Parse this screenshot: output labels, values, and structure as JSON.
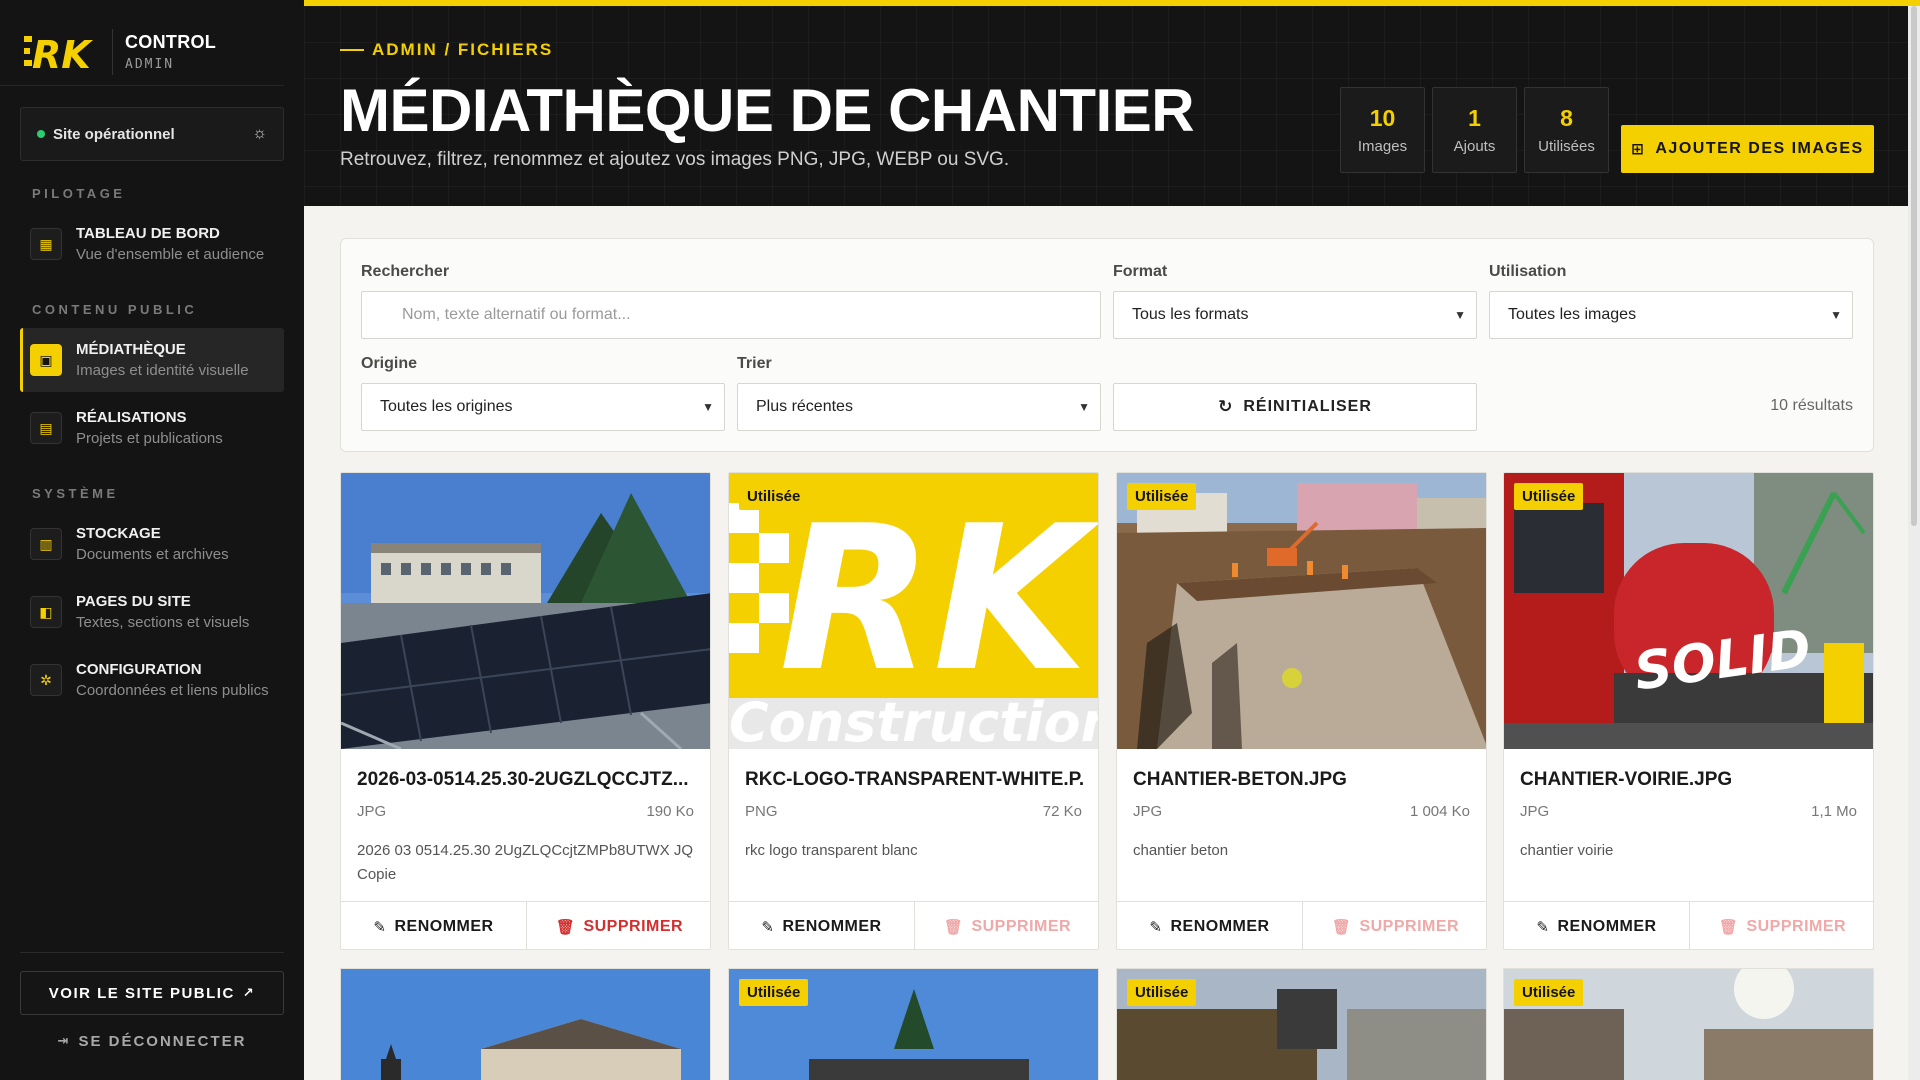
{
  "brand": {
    "logo_text": "RK",
    "title": "CONTROL",
    "subtitle": "ADMIN"
  },
  "status": {
    "text": "Site opérationnel",
    "color": "#2ecc71"
  },
  "sidebar": {
    "sections": [
      "PILOTAGE",
      "CONTENU PUBLIC",
      "SYSTÈME"
    ],
    "items": [
      {
        "label": "TABLEAU DE BORD",
        "desc": "Vue d'ensemble et audience"
      },
      {
        "label": "MÉDIATHÈQUE",
        "desc": "Images et identité visuelle"
      },
      {
        "label": "RÉALISATIONS",
        "desc": "Projets et publications"
      },
      {
        "label": "STOCKAGE",
        "desc": "Documents et archives"
      },
      {
        "label": "PAGES DU SITE",
        "desc": "Textes, sections et visuels"
      },
      {
        "label": "CONFIGURATION",
        "desc": "Coordonnées et liens publics"
      }
    ],
    "public_button": "VOIR LE SITE PUBLIC",
    "logout": "SE DÉCONNECTER"
  },
  "header": {
    "breadcrumb": "ADMIN / FICHIERS",
    "title": "MÉDIATHÈQUE DE CHANTIER",
    "subtitle": "Retrouvez, filtrez, renommez et ajoutez vos images PNG, JPG, WEBP ou SVG.",
    "stats": [
      {
        "value": "10",
        "label": "Images"
      },
      {
        "value": "1",
        "label": "Ajouts"
      },
      {
        "value": "8",
        "label": "Utilisées"
      }
    ],
    "add_button": "AJOUTER DES IMAGES"
  },
  "filters": {
    "search_label": "Rechercher",
    "search_placeholder": "Nom, texte alternatif ou format...",
    "format_label": "Format",
    "format_value": "Tous les formats",
    "usage_label": "Utilisation",
    "usage_value": "Toutes les images",
    "origin_label": "Origine",
    "origin_value": "Toutes les origines",
    "sort_label": "Trier",
    "sort_value": "Plus récentes",
    "reset_button": "RÉINITIALISER",
    "results": "10 résultats"
  },
  "cards": [
    {
      "name": "2026-03-0514.25.30-2UGZLQCCJTZ...",
      "format": "JPG",
      "size": "190 Ko",
      "desc": "2026 03 0514.25.30 2UgZLQCcjtZMPb8UTWX JQ Copie",
      "used": false,
      "rename": "RENOMMER",
      "delete": "SUPPRIMER"
    },
    {
      "name": "RKC-LOGO-TRANSPARENT-WHITE.P...",
      "format": "PNG",
      "size": "72 Ko",
      "desc": "rkc logo transparent blanc",
      "used": true,
      "badge": "Utilisée",
      "rename": "RENOMMER",
      "delete": "SUPPRIMER",
      "logo_big": "RK",
      "logo_word": "Constructions"
    },
    {
      "name": "CHANTIER-BETON.JPG",
      "format": "JPG",
      "size": "1 004 Ko",
      "desc": "chantier beton",
      "used": true,
      "badge": "Utilisée",
      "rename": "RENOMMER",
      "delete": "SUPPRIMER"
    },
    {
      "name": "CHANTIER-VOIRIE.JPG",
      "format": "JPG",
      "size": "1,1 Mo",
      "desc": "chantier voirie",
      "used": true,
      "badge": "Utilisée",
      "rename": "RENOMMER",
      "delete": "SUPPRIMER",
      "truck_text": "SOLID"
    }
  ],
  "row2_badges": [
    "Utilisée",
    "Utilisée",
    "Utilisée"
  ],
  "colors": {
    "accent": "#f5d000",
    "dark": "#141414",
    "danger": "#d32f2f"
  }
}
